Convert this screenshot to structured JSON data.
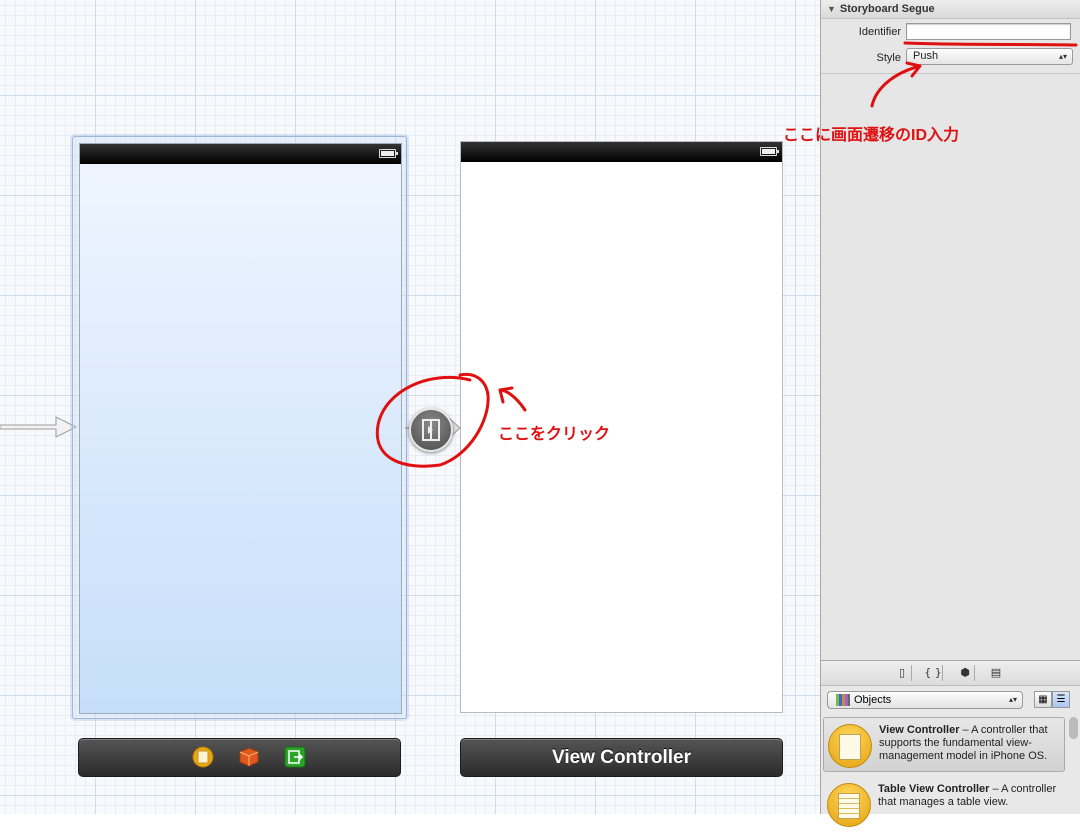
{
  "inspector": {
    "section_title": "Storyboard Segue",
    "identifier_label": "Identifier",
    "identifier_value": "",
    "style_label": "Style",
    "style_value": "Push"
  },
  "canvas": {
    "scene2_title": "View Controller"
  },
  "annotations": {
    "click_here": "ここをクリック",
    "enter_id": "ここに画面遷移のID入力",
    "color": "#e01010"
  },
  "library": {
    "tabs": [
      "file-template-icon",
      "code-snippet-icon",
      "object-cube-icon",
      "media-icon"
    ],
    "filter_value": "Objects",
    "items": [
      {
        "title": "View Controller",
        "desc": " – A controller that supports the fundamental view-management model in iPhone OS."
      },
      {
        "title": "Table View Controller",
        "desc": " – A controller that manages a table view."
      }
    ]
  },
  "colors": {
    "canvas_grid": "#cfdcea",
    "scene_selected": "#c6defa",
    "annotation_red": "#e01010"
  }
}
